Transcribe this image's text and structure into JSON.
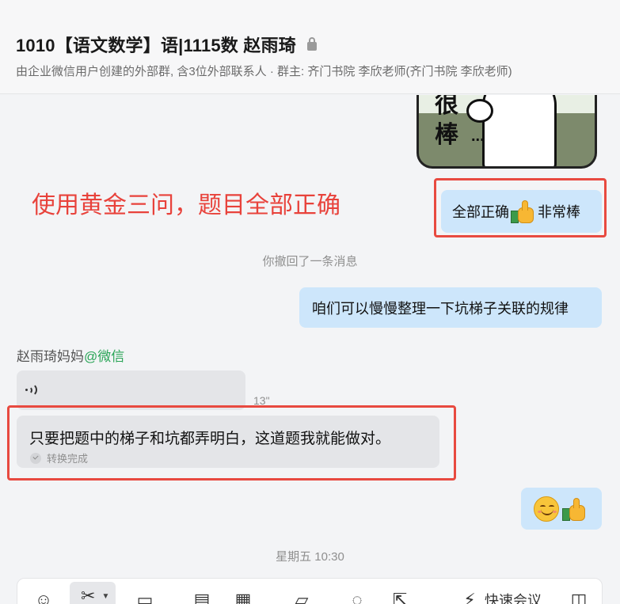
{
  "header": {
    "title": "1010【语文数学】语|1115数 赵雨琦",
    "subtitle": "由企业微信用户创建的外部群, 含3位外部联系人 · 群主: 齐门书院 李欣老师(齐门书院 李欣老师)"
  },
  "sticker": {
    "char1": "很",
    "char2": "棒",
    "dots": "..."
  },
  "annotation": "使用黄金三问，题目全部正确",
  "messages": {
    "self1_prefix": "全部正确",
    "self1_suffix": "非常棒",
    "recalled": "你撤回了一条消息",
    "self2": "咱们可以慢慢整理一下坑梯子关联的规律",
    "sender_name": "赵雨琦妈妈",
    "sender_tag": "@微信",
    "voice_duration": "13\"",
    "transcript": "只要把题中的梯子和坑都弄明白，这道题我就能做对。",
    "transcript_status": "转换完成",
    "time_divider": "星期五 10:30"
  },
  "toolbar": {
    "quick_meeting_label": "快速会议",
    "items": [
      "emoji-icon",
      "scissors-icon",
      "image-icon",
      "document-icon",
      "calendar-icon",
      "folder-icon",
      "chat-icon",
      "share-icon",
      "quick-meeting-icon",
      "panel-icon"
    ]
  },
  "colors": {
    "annotation_red": "#e8423b",
    "self_bubble": "#cde6fb",
    "other_bubble": "#e4e5e8",
    "wechat_green": "#2aa557"
  }
}
